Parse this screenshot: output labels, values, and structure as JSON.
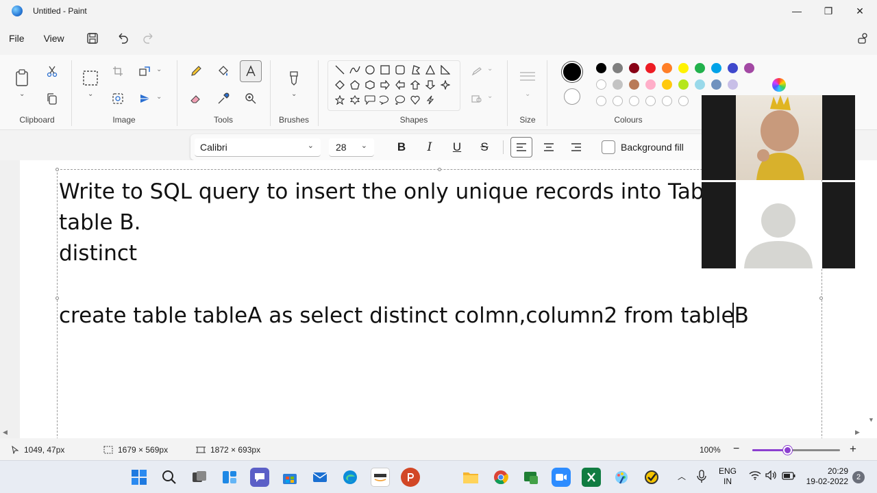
{
  "window": {
    "title": "Untitled - Paint",
    "minimize_glyph": "—",
    "maximize_glyph": "❐",
    "close_glyph": "✕"
  },
  "menu": {
    "file": "File",
    "view": "View"
  },
  "ribbon": {
    "groups": {
      "clipboard": "Clipboard",
      "image": "Image",
      "tools": "Tools",
      "brushes": "Brushes",
      "shapes": "Shapes",
      "size": "Size",
      "colours": "Colours"
    },
    "colours_row1": [
      "#000000",
      "#7f7f7f",
      "#880015",
      "#ed1c24",
      "#ff7f27",
      "#fff200",
      "#22b14c",
      "#00a2e8",
      "#3f48cc",
      "#a349a4"
    ],
    "colours_row2": [
      "#ffffff",
      "#c3c3c3",
      "#b97a57",
      "#ffaec9",
      "#ffc90e",
      "#b5e61d",
      "#99d9ea",
      "#7092be",
      "#c8bfe7"
    ],
    "colour1": "#000000",
    "colour2": "#ffffff"
  },
  "text_format": {
    "font": "Calibri",
    "size": "28",
    "bold": "B",
    "italic": "I",
    "underline": "U",
    "strike": "S",
    "background_fill": "Background fill"
  },
  "canvas": {
    "lines": [
      "Write to SQL query to insert the only unique records into Table A from",
      "table B.",
      "distinct",
      "create table tableA as select distinct colmn,column2 from tableB"
    ]
  },
  "status": {
    "cursor_position": "1049, 47px",
    "selection_size": "1679 × 569px",
    "canvas_size": "1872 × 693px",
    "zoom": "100%",
    "zoom_level": 0.4
  },
  "taskbar": {
    "language_top": "ENG",
    "language_bottom": "IN",
    "time": "20:29",
    "date": "19-02-2022",
    "notification_count": "2"
  }
}
